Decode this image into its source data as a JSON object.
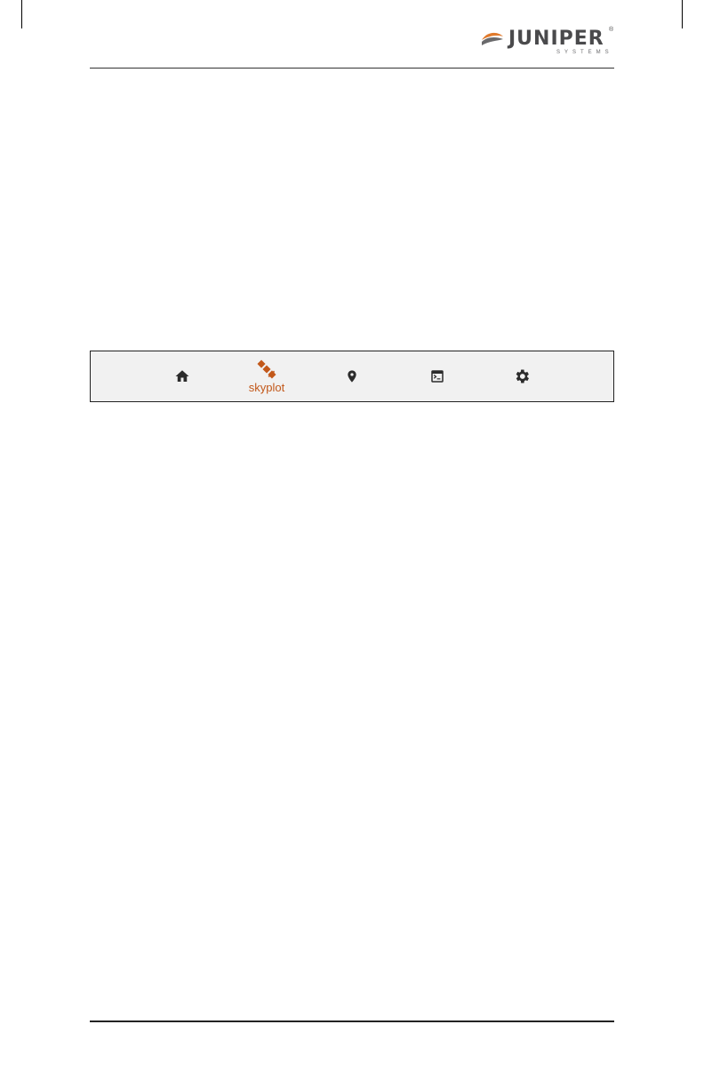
{
  "header": {
    "logo_word": "JUNIPER",
    "logo_registered": "®",
    "logo_sub": "SYSTEMS"
  },
  "navbar": {
    "items": [
      {
        "icon": "home-icon",
        "label": ""
      },
      {
        "icon": "satellite-icon",
        "label": "skyplot",
        "active": true
      },
      {
        "icon": "location-pin-icon",
        "label": ""
      },
      {
        "icon": "terminal-icon",
        "label": ""
      },
      {
        "icon": "gear-icon",
        "label": ""
      }
    ],
    "active_color": "#c2581a",
    "icon_color": "#2b2b2b",
    "background": "#f1f1f1"
  }
}
